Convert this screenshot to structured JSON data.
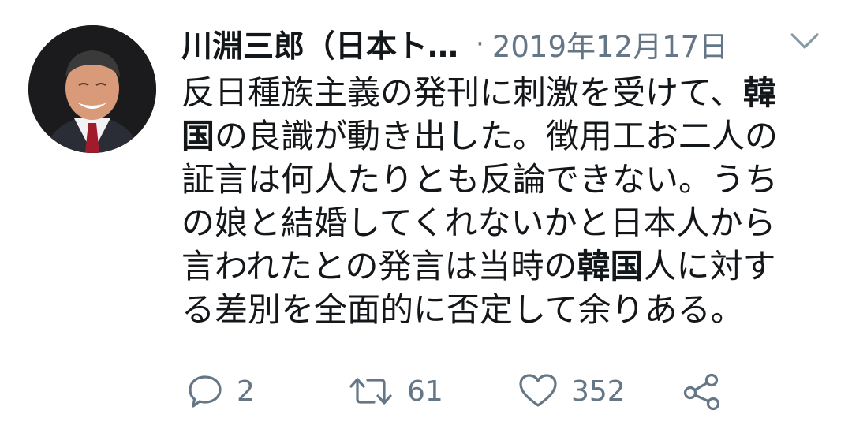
{
  "tweet": {
    "author_name": "川淵三郎（日本ト…",
    "separator": "·",
    "date": "2019年12月17日",
    "lines": [
      [
        {
          "t": "反日種族主義の発刊に刺激を受けて、",
          "b": false
        },
        {
          "t": "韓",
          "b": true
        }
      ],
      [
        {
          "t": "国",
          "b": true
        },
        {
          "t": "の良識が動き出した。徴用工お二人の",
          "b": false
        }
      ],
      [
        {
          "t": "証言は何人たりとも反論できない。うち",
          "b": false
        }
      ],
      [
        {
          "t": "の娘と結婚してくれないかと日本人から",
          "b": false
        }
      ],
      [
        {
          "t": "言われたとの発言は当時の",
          "b": false
        },
        {
          "t": "韓国",
          "b": true
        },
        {
          "t": "人に対す",
          "b": false
        }
      ],
      [
        {
          "t": "る差別を全面的に否定して余りある。",
          "b": false
        }
      ]
    ]
  },
  "actions": {
    "reply_count": "2",
    "retweet_count": "61",
    "like_count": "352"
  },
  "icons": {
    "chevron": "chevron-down-icon",
    "reply": "reply-icon",
    "retweet": "retweet-icon",
    "like": "like-icon",
    "share": "share-icon"
  },
  "colors": {
    "text": "#14171a",
    "secondary": "#657786",
    "background": "#ffffff"
  }
}
